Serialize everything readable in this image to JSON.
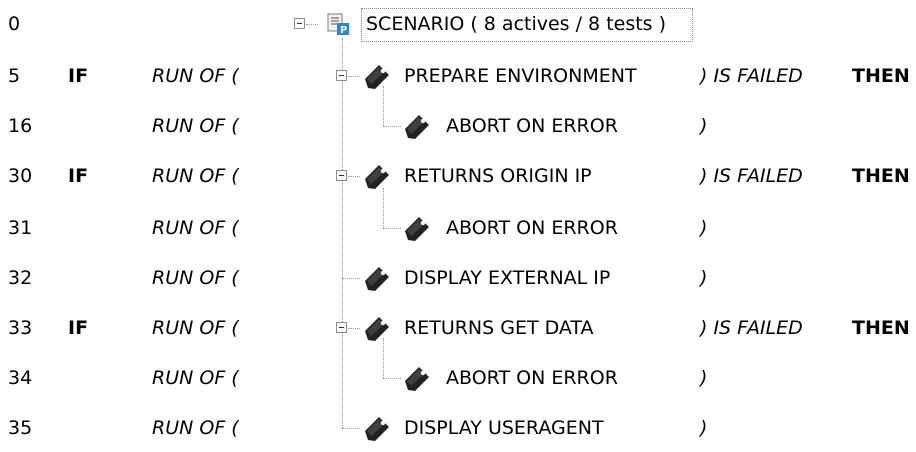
{
  "rows": [
    {
      "num": "0",
      "label": "SCENARIO ( 8 actives / 8 tests )"
    },
    {
      "num": "5",
      "if": "IF",
      "runof": "RUN OF (",
      "label": "PREPARE ENVIRONMENT",
      "close": ") IS FAILED",
      "then": "THEN"
    },
    {
      "num": "16",
      "runof": "RUN OF (",
      "label": "ABORT ON ERROR",
      "close": ")"
    },
    {
      "num": "30",
      "if": "IF",
      "runof": "RUN OF (",
      "label": "RETURNS ORIGIN IP",
      "close": ") IS FAILED",
      "then": "THEN"
    },
    {
      "num": "31",
      "runof": "RUN OF (",
      "label": "ABORT ON ERROR",
      "close": ")"
    },
    {
      "num": "32",
      "runof": "RUN OF (",
      "label": "DISPLAY EXTERNAL IP",
      "close": ")"
    },
    {
      "num": "33",
      "if": "IF",
      "runof": "RUN OF (",
      "label": "RETURNS GET DATA",
      "close": ") IS FAILED",
      "then": "THEN"
    },
    {
      "num": "34",
      "runof": "RUN OF (",
      "label": "ABORT ON ERROR",
      "close": ")"
    },
    {
      "num": "35",
      "runof": "RUN OF (",
      "label": "DISPLAY USERAGENT",
      "close": ")"
    }
  ],
  "icons": {
    "scenario": "scenario-document-icon",
    "test": "test-tag-icon",
    "collapse": "collapse-minus-icon"
  },
  "colors": {
    "scenario_badge": "#2a86d6",
    "tree_lines": "#9a9a9a"
  }
}
